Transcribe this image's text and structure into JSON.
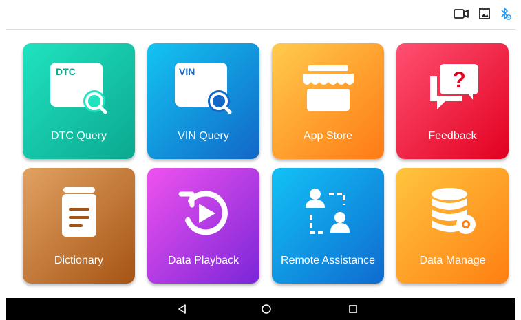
{
  "status": {
    "icons": [
      "video-camera-icon",
      "gallery-image-icon",
      "bluetooth-icon"
    ],
    "bluetooth_color": "#2196f3"
  },
  "tiles": [
    {
      "label": "DTC Query",
      "icon": "dtc-search-icon",
      "badge_text": "DTC",
      "colors": [
        "#20e3c0",
        "#0ba88f"
      ]
    },
    {
      "label": "VIN Query",
      "icon": "vin-search-icon",
      "badge_text": "VIN",
      "colors": [
        "#13c4f2",
        "#1267c7"
      ]
    },
    {
      "label": "App Store",
      "icon": "storefront-icon",
      "colors": [
        "#ffcb4d",
        "#ff7a14"
      ]
    },
    {
      "label": "Feedback",
      "icon": "chat-question-icon",
      "colors": [
        "#ff5072",
        "#e2001f"
      ]
    },
    {
      "label": "Dictionary",
      "icon": "book-icon",
      "colors": [
        "#e2a262",
        "#a55414"
      ]
    },
    {
      "label": "Data Playback",
      "icon": "replay-icon",
      "colors": [
        "#ef52ef",
        "#7a26d8"
      ]
    },
    {
      "label": "Remote Assistance",
      "icon": "remote-users-icon",
      "colors": [
        "#12c2f6",
        "#0f6bd0"
      ]
    },
    {
      "label": "Data Manage",
      "icon": "database-gear-icon",
      "colors": [
        "#ffc53e",
        "#ff7f12"
      ]
    }
  ],
  "navbar": {
    "back_glyph": "◁",
    "home_glyph": "○",
    "recent_glyph": "□"
  }
}
